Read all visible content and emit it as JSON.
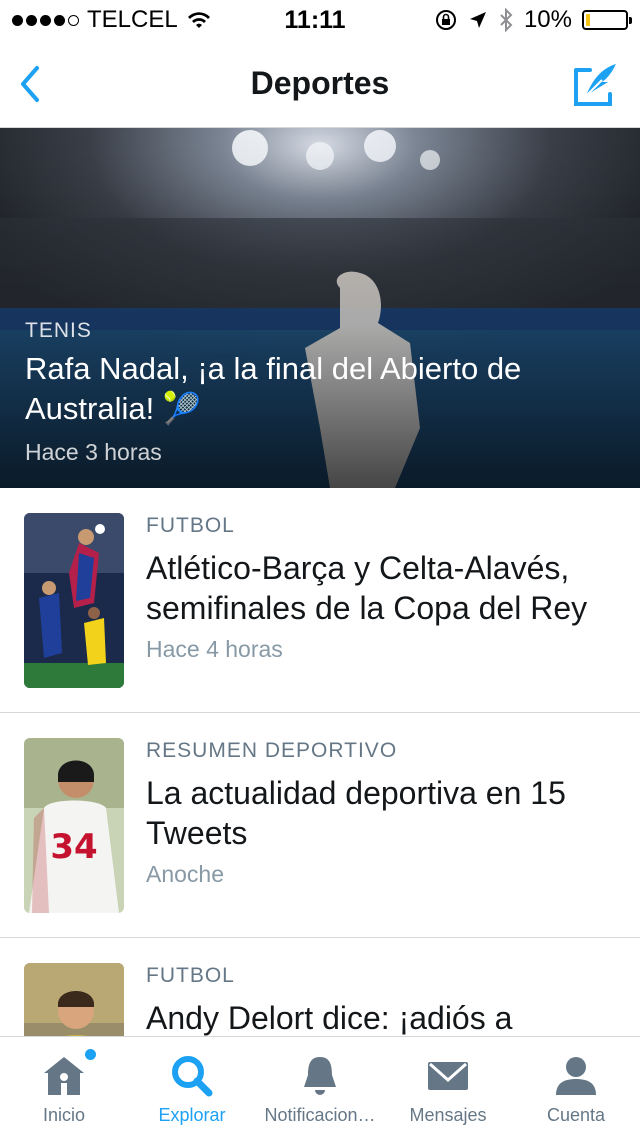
{
  "status_bar": {
    "carrier": "TELCEL",
    "time": "11:11",
    "battery": "10%",
    "battery_level": 0.1,
    "signal_bars": 4
  },
  "nav": {
    "title": "Deportes",
    "back_icon": "chevron-left-icon",
    "compose_icon": "compose-feather-icon"
  },
  "hero": {
    "category": "TENIS",
    "title": "Rafa Nadal, ¡a la final del Abierto de Australia! 🎾",
    "time": "Hace 3 horas"
  },
  "stories": [
    {
      "category": "FUTBOL",
      "title": "Atlético-Barça y Celta-Alavés, semifinales de la Copa del Rey",
      "time": "Hace 4 horas"
    },
    {
      "category": "RESUMEN DEPORTIVO",
      "title": "La actualidad deportiva en 15 Tweets",
      "time": "Anoche"
    },
    {
      "category": "FUTBOL",
      "title": "Andy Delort dice: ¡adiós a",
      "time": ""
    }
  ],
  "tabs": [
    {
      "label": "Inicio",
      "icon": "home-icon",
      "active": false,
      "badge": true
    },
    {
      "label": "Explorar",
      "icon": "search-icon",
      "active": true,
      "badge": false
    },
    {
      "label": "Notificacion…",
      "icon": "bell-icon",
      "active": false,
      "badge": false
    },
    {
      "label": "Mensajes",
      "icon": "envelope-icon",
      "active": false,
      "badge": false
    },
    {
      "label": "Cuenta",
      "icon": "person-icon",
      "active": false,
      "badge": false
    }
  ],
  "colors": {
    "accent": "#1da1f2",
    "text_primary": "#14171a",
    "text_secondary": "#657786",
    "divider": "#d6d9dc",
    "battery_low": "#f5c518"
  }
}
